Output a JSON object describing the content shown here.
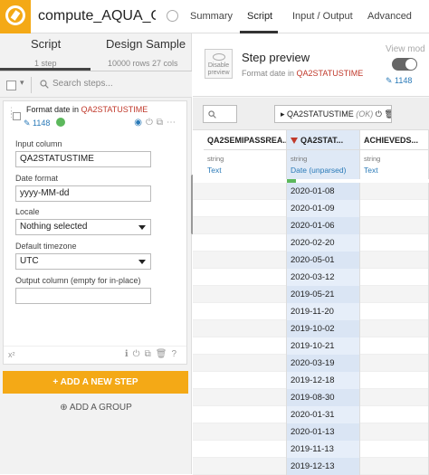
{
  "app": {
    "recipe_title": "compute_AQUA_OU...",
    "tabs": [
      "Summary",
      "Script",
      "Input / Output",
      "Advanced"
    ],
    "active_tab": "Script"
  },
  "left": {
    "tabs": [
      {
        "label": "Script",
        "sub": "1 step"
      },
      {
        "label": "Design Sample",
        "sub": "10000 rows 27 cols"
      }
    ],
    "search_placeholder": "Search steps...",
    "step": {
      "title_prefix": "Format date in",
      "title_column": "QA2STATUSTIME",
      "count": "1148",
      "fields": {
        "input_column_label": "Input column",
        "input_column_value": "QA2STATUSTIME",
        "date_format_label": "Date format",
        "date_format_value": "yyyy-MM-dd",
        "locale_label": "Locale",
        "locale_value": "Nothing selected",
        "timezone_label": "Default timezone",
        "timezone_value": "UTC",
        "output_label": "Output column (empty for in-place)",
        "output_value": ""
      },
      "fx": "x²"
    },
    "add_step": "+ ADD A NEW STEP",
    "add_group": "ADD A GROUP"
  },
  "right": {
    "disable_label": "Disable preview",
    "title": "Step preview",
    "subtitle_prefix": "Format date in",
    "subtitle_column": "QA2STATUSTIME",
    "view_mode": "View mod",
    "count": "1148",
    "col_pill": "QA2STATUSTIME",
    "col_pill_status": "(OK)",
    "columns": [
      {
        "name": "QA2SEMIPASSREA...",
        "storage": "string",
        "meaning": "Text"
      },
      {
        "name": "QA2STAT...",
        "storage": "string",
        "meaning": "Date (unparsed)"
      },
      {
        "name": "ACHIEVEDS...",
        "storage": "string",
        "meaning": "Text"
      }
    ],
    "rows": [
      "2020-01-08",
      "2020-01-09",
      "2020-01-06",
      "2020-02-20",
      "2020-05-01",
      "2020-03-12",
      "2019-05-21",
      "2019-11-20",
      "2019-10-02",
      "2019-10-21",
      "2020-03-19",
      "2019-12-18",
      "2019-08-30",
      "2020-01-31",
      "2020-01-13",
      "2019-11-13",
      "2019-12-13"
    ]
  }
}
